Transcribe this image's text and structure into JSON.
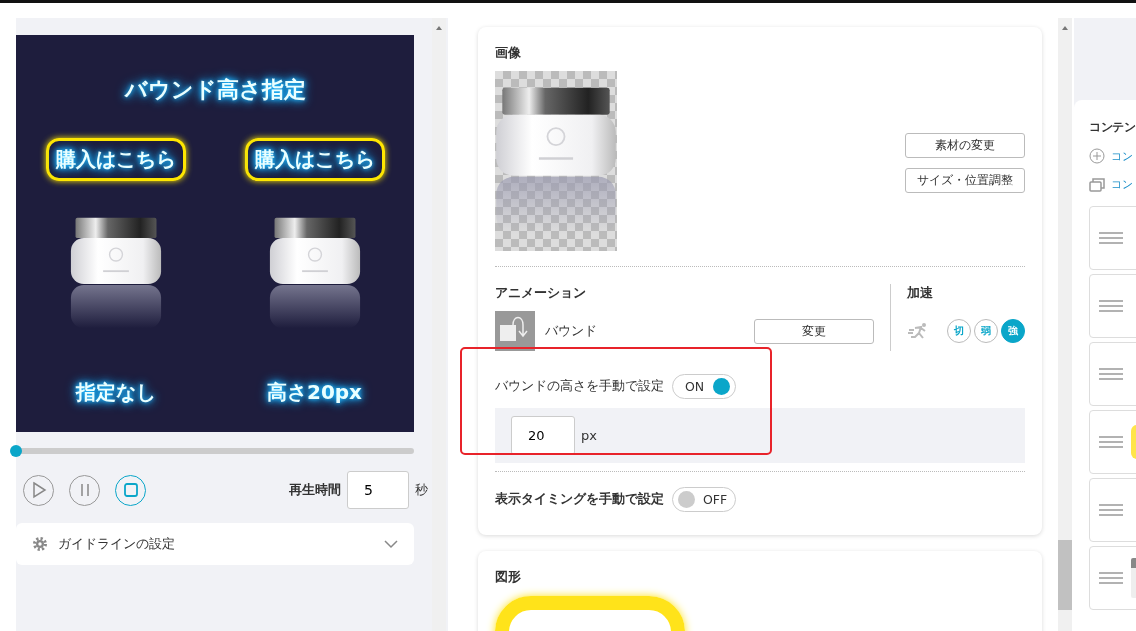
{
  "preview": {
    "title": "バウンド高さ指定",
    "columns": [
      {
        "button": "購入はこちら",
        "caption": "指定なし"
      },
      {
        "button": "購入はこちら",
        "caption": "高さ20px"
      }
    ]
  },
  "timeline": {
    "level": 0
  },
  "playback": {
    "buttons": [
      {
        "kind": "play",
        "selected": false
      },
      {
        "kind": "pause",
        "selected": false
      },
      {
        "kind": "stop",
        "selected": true
      }
    ],
    "duration_label": "再生時間",
    "duration": "5",
    "unit": "秒"
  },
  "guideline": {
    "label": "ガイドラインの設定",
    "expanded": false
  },
  "image_section": {
    "title": "画像",
    "buttons": [
      "素材の変更",
      "サイズ・位置調整"
    ]
  },
  "animation": {
    "title": "アニメーション",
    "name": "バウンド",
    "change_button": "変更",
    "acceleration_title": "加速",
    "acceleration_options": [
      {
        "label": "切",
        "selected": false
      },
      {
        "label": "弱",
        "selected": false
      },
      {
        "label": "強",
        "selected": true
      }
    ]
  },
  "bounce_height": {
    "label": "バウンドの高さを手動で設定",
    "on": true,
    "toggle_text": "ON",
    "value": "20",
    "unit": "px"
  },
  "timing": {
    "label": "表示タイミングを手動で設定",
    "on": false,
    "toggle_text": "OFF"
  },
  "shape_section": {
    "title": "図形"
  },
  "contents_panel": {
    "title": "コンテン",
    "links": [
      {
        "kind": "add",
        "label": "コン"
      },
      {
        "kind": "layers",
        "label": "コン"
      }
    ],
    "items": [
      {
        "kind": "plain"
      },
      {
        "kind": "plain"
      },
      {
        "kind": "plain"
      },
      {
        "kind": "shape"
      },
      {
        "kind": "plain"
      },
      {
        "kind": "image"
      }
    ]
  }
}
